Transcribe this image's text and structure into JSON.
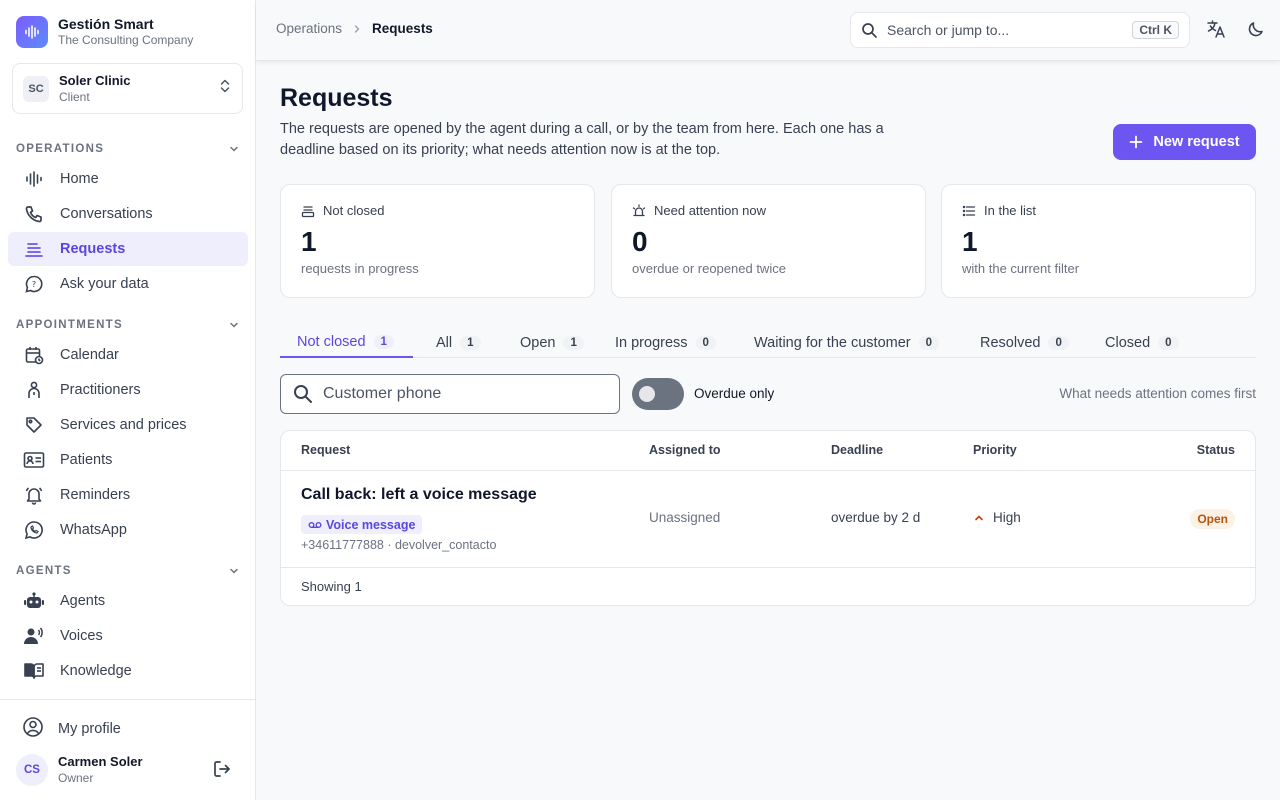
{
  "brand": {
    "name": "Gestión Smart",
    "company": "The Consulting Company"
  },
  "client": {
    "initials": "SC",
    "name": "Soler Clinic",
    "role": "Client"
  },
  "sidebar": {
    "sections": [
      {
        "title": "OPERATIONS",
        "items": [
          {
            "label": "Home",
            "icon": "waveform-icon"
          },
          {
            "label": "Conversations",
            "icon": "phone-icon"
          },
          {
            "label": "Requests",
            "icon": "list-icon",
            "active": true
          },
          {
            "label": "Ask your data",
            "icon": "chat-bubble-icon"
          }
        ]
      },
      {
        "title": "APPOINTMENTS",
        "items": [
          {
            "label": "Calendar",
            "icon": "calendar-icon"
          },
          {
            "label": "Practitioners",
            "icon": "person-icon"
          },
          {
            "label": "Services and prices",
            "icon": "tag-icon"
          },
          {
            "label": "Patients",
            "icon": "id-card-icon"
          },
          {
            "label": "Reminders",
            "icon": "bell-icon"
          },
          {
            "label": "WhatsApp",
            "icon": "whatsapp-icon"
          }
        ]
      },
      {
        "title": "AGENTS",
        "items": [
          {
            "label": "Agents",
            "icon": "robot-icon"
          },
          {
            "label": "Voices",
            "icon": "voice-icon"
          },
          {
            "label": "Knowledge",
            "icon": "book-icon"
          }
        ]
      }
    ],
    "footer": {
      "profile_label": "My profile",
      "user_initials": "CS",
      "user_name": "Carmen Soler",
      "user_role": "Owner"
    }
  },
  "topbar": {
    "breadcrumb": [
      "Operations",
      "Requests"
    ],
    "search_placeholder": "Search or jump to...",
    "search_shortcut": "Ctrl K"
  },
  "page": {
    "title": "Requests",
    "description": "The requests are opened by the agent during a call, or by the team from here. Each one has a deadline based on its priority; what needs attention now is at the top.",
    "new_button": "New request"
  },
  "stats": [
    {
      "label": "Not closed",
      "value": "1",
      "sub": "requests in progress",
      "icon": "inbox-icon"
    },
    {
      "label": "Need attention now",
      "value": "0",
      "sub": "overdue or reopened twice",
      "icon": "alarm-icon"
    },
    {
      "label": "In the list",
      "value": "1",
      "sub": "with the current filter",
      "icon": "list-icon"
    }
  ],
  "tabs": [
    {
      "label": "Not closed",
      "count": "1",
      "active": true
    },
    {
      "label": "All",
      "count": "1"
    },
    {
      "label": "Open",
      "count": "1"
    },
    {
      "label": "In progress",
      "count": "0"
    },
    {
      "label": "Waiting for the customer",
      "count": "0"
    },
    {
      "label": "Resolved",
      "count": "0"
    },
    {
      "label": "Closed",
      "count": "0"
    }
  ],
  "filters": {
    "phone_placeholder": "Customer phone",
    "overdue_label": "Overdue only",
    "overdue_on": false,
    "hint": "What needs attention comes first"
  },
  "table": {
    "headers": {
      "request": "Request",
      "assigned": "Assigned to",
      "deadline": "Deadline",
      "priority": "Priority",
      "status": "Status"
    },
    "rows": [
      {
        "title": "Call back: left a voice message",
        "tag": "Voice message",
        "meta": "+34611777888 · devolver_contacto",
        "assigned": "Unassigned",
        "deadline": "overdue by 2 d",
        "priority": "High",
        "status": "Open"
      }
    ],
    "footer": "Showing 1"
  },
  "colors": {
    "accent": "#6c55f0",
    "status_open_bg": "#fdf1e6",
    "status_open_text": "#b4540d"
  }
}
